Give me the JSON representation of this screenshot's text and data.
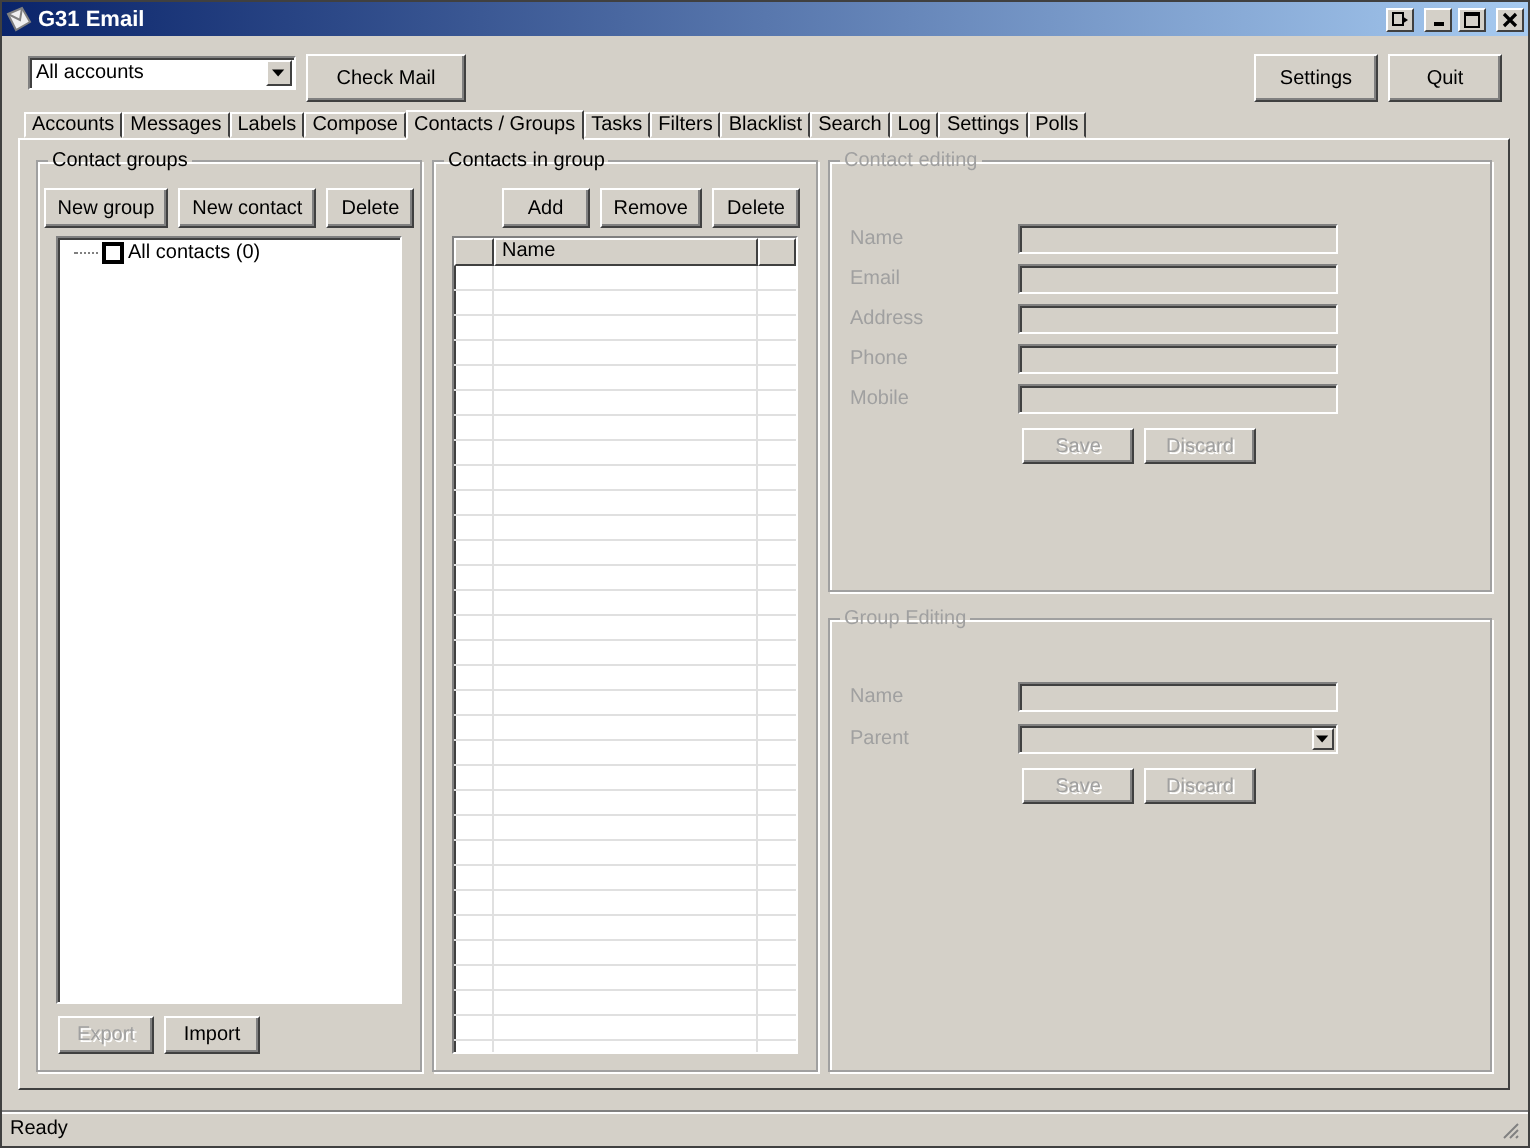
{
  "window": {
    "title": "G31 Email"
  },
  "toolbar": {
    "account_select": {
      "value": "All accounts"
    },
    "check_button": {
      "label": "Check Mail"
    },
    "right_buttons": [
      {
        "label": "Settings"
      },
      {
        "label": "Quit"
      }
    ]
  },
  "tabs": [
    {
      "label": "Accounts",
      "selected": false
    },
    {
      "label": "Messages",
      "selected": false
    },
    {
      "label": "Labels",
      "selected": false
    },
    {
      "label": "Compose",
      "selected": false
    },
    {
      "label": "Contacts / Groups",
      "selected": true
    },
    {
      "label": "Tasks",
      "selected": false
    },
    {
      "label": "Filters",
      "selected": false
    },
    {
      "label": "Blacklist",
      "selected": false
    },
    {
      "label": "Search",
      "selected": false
    },
    {
      "label": "Log",
      "selected": false
    },
    {
      "label": "Settings",
      "selected": false
    },
    {
      "label": "Polls",
      "selected": false
    }
  ],
  "contact_groups": {
    "title": "Contact groups",
    "buttons": [
      {
        "label": "New group",
        "disabled": false
      },
      {
        "label": "New contact",
        "disabled": false
      },
      {
        "label": "Delete",
        "disabled": false
      }
    ],
    "tree": [
      {
        "label": "All contacts (0)",
        "checked": false
      }
    ],
    "bottom_buttons": [
      {
        "label": "Export",
        "disabled": true
      },
      {
        "label": "Import",
        "disabled": false
      }
    ]
  },
  "contacts_in_group": {
    "title": "Contacts in group",
    "buttons": [
      {
        "label": "Add",
        "disabled": false
      },
      {
        "label": "Remove",
        "disabled": false
      },
      {
        "label": "Delete",
        "disabled": false
      }
    ],
    "table": {
      "columns": [
        "Name"
      ]
    }
  },
  "contact_editing": {
    "title": "Contact editing",
    "fields": [
      {
        "label": "Name",
        "kind": "text",
        "disabled": true
      },
      {
        "label": "Email",
        "kind": "text",
        "disabled": true
      },
      {
        "label": "Address",
        "kind": "text",
        "disabled": true
      },
      {
        "label": "Phone",
        "kind": "text",
        "disabled": true
      },
      {
        "label": "Mobile",
        "kind": "text",
        "disabled": true
      }
    ],
    "buttons": [
      {
        "label": "Save",
        "disabled": true
      },
      {
        "label": "Discard",
        "disabled": true
      }
    ]
  },
  "group_editing": {
    "title": "Group Editing",
    "fields": [
      {
        "label": "Name",
        "kind": "text",
        "disabled": true
      },
      {
        "label": "Parent",
        "kind": "dropdown",
        "disabled": true
      }
    ],
    "buttons": [
      {
        "label": "Save",
        "disabled": true
      },
      {
        "label": "Discard",
        "disabled": true
      }
    ]
  },
  "status_bar": {
    "text": "Ready"
  }
}
